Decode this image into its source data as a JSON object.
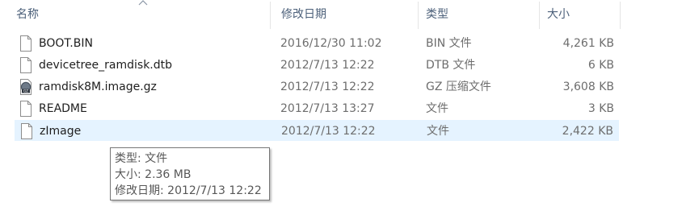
{
  "columns": {
    "name": "名称",
    "date": "修改日期",
    "type": "类型",
    "size": "大小"
  },
  "files": [
    {
      "name": "BOOT.BIN",
      "date": "2016/12/30 11:02",
      "type": "BIN 文件",
      "size": "4,261 KB",
      "icon": "file-icon"
    },
    {
      "name": "devicetree_ramdisk.dtb",
      "date": "2012/7/13 12:22",
      "type": "DTB 文件",
      "size": "6 KB",
      "icon": "file-icon"
    },
    {
      "name": "ramdisk8M.image.gz",
      "date": "2012/7/13 12:22",
      "type": "GZ 压缩文件",
      "size": "3,608 KB",
      "icon": "archive-icon"
    },
    {
      "name": "README",
      "date": "2012/7/13 13:27",
      "type": "文件",
      "size": "3 KB",
      "icon": "file-icon"
    },
    {
      "name": "zImage",
      "date": "2012/7/13 12:22",
      "type": "文件",
      "size": "2,422 KB",
      "icon": "file-icon"
    }
  ],
  "selected_index": 4,
  "tooltip": {
    "type_line": "类型: 文件",
    "size_line": "大小: 2.36 MB",
    "date_line": "修改日期: 2012/7/13 12:22"
  },
  "colors": {
    "header_text": "#4c607a",
    "selected_row": "#e5f3ff",
    "detail_text": "#6d6d6d"
  }
}
